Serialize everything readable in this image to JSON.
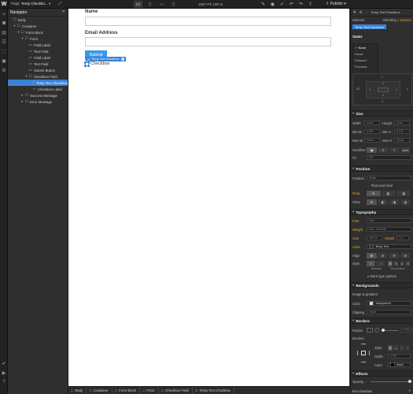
{
  "topbar": {
    "logo": "W",
    "page_label": "Page:",
    "page_name": "Temp Checkbo...",
    "dimensions": "1067 PX  100 %",
    "publish_label": "Publish"
  },
  "navigator": {
    "title": "Navigator",
    "items": [
      {
        "label": "Body",
        "level": 0,
        "caret": "",
        "icon": "☐"
      },
      {
        "label": "Container",
        "level": 1,
        "caret": "▾",
        "icon": "☐"
      },
      {
        "label": "Form Block",
        "level": 2,
        "caret": "▾",
        "icon": "☐"
      },
      {
        "label": "Form",
        "level": 3,
        "caret": "▾",
        "icon": "☐"
      },
      {
        "label": "Field Label",
        "level": 4,
        "caret": "",
        "icon": "▭"
      },
      {
        "label": "Text Field",
        "level": 4,
        "caret": "",
        "icon": "▭"
      },
      {
        "label": "Field Label",
        "level": 4,
        "caret": "",
        "icon": "▭"
      },
      {
        "label": "Text Field",
        "level": 4,
        "caret": "",
        "icon": "▭"
      },
      {
        "label": "Submit Button",
        "level": 4,
        "caret": "",
        "icon": "▭"
      },
      {
        "label": "Checkbox Field",
        "level": 4,
        "caret": "▾",
        "icon": "☐"
      },
      {
        "label": "Temp Text Checkbox",
        "level": 5,
        "caret": "",
        "icon": "☑",
        "selected": true
      },
      {
        "label": "Checkbox Label",
        "level": 5,
        "caret": "",
        "icon": "▭"
      },
      {
        "label": "Success Message",
        "level": 3,
        "caret": "▸",
        "icon": "☐"
      },
      {
        "label": "Error Message",
        "level": 3,
        "caret": "▸",
        "icon": "☐"
      }
    ]
  },
  "canvas": {
    "name_label": "Name",
    "email_label": "Email Address",
    "submit_label": "Submit",
    "element_tag": "Temp Text Checkbox",
    "checkbox_label": "Checkbox"
  },
  "breadcrumbs": [
    "Body",
    "Container",
    "Form Block",
    "Form",
    "Checkbox Field",
    "Temp Text Checkbox"
  ],
  "right_panel": {
    "header_title": "Temp Text Checkbox",
    "selector_label": "Selector",
    "inheriting_label": "Inheriting",
    "inheriting_count": "1 selector",
    "selector_chip": "Temp Text Checkbox",
    "states_title": "States",
    "states": [
      "None",
      "Hover",
      "Pressed",
      "Focused"
    ],
    "box_values": {
      "margin_top": "0",
      "margin_left": "-20",
      "padding_top": "0",
      "padding_left": "0",
      "padding_right": "0",
      "padding_bottom": "0",
      "margin_right": "0",
      "margin_bottom": "0"
    },
    "size": {
      "title": "Size",
      "width_label": "Width",
      "width_value": "Auto",
      "height_label": "Height",
      "height_value": "Auto",
      "minw_label": "Min W",
      "minw_value": "0",
      "minw_unit": "PX",
      "minh_label": "Min H",
      "minh_value": "0",
      "minh_unit": "PX",
      "maxw_label": "Max W",
      "maxw_value": "None",
      "maxh_label": "Max H",
      "maxh_value": "None",
      "overflow_label": "Overflow",
      "overflow_auto": "Auto",
      "fit_label": "Fit",
      "fit_value": "Fill"
    },
    "position": {
      "title": "Position",
      "position_label": "Position",
      "position_value": "Static",
      "float_clear": "Float and clear",
      "float_label": "Float",
      "clear_label": "Clear"
    },
    "typography": {
      "title": "Typography",
      "font_label": "Font",
      "font_value": "Inter",
      "weight_label": "Weight",
      "weight_value": "400 - Normal",
      "size_label": "Size",
      "size_value": "100",
      "size_unit": "%",
      "height_label": "Height",
      "height_value": "1.2",
      "color_label": "Color",
      "color_value": "Body Text",
      "align_label": "Align",
      "style_label": "Style",
      "italicize_label": "Italicize",
      "decoration_label": "Decoration",
      "more_label": "More type options"
    },
    "backgrounds": {
      "title": "Backgrounds",
      "image_gradient": "Image & gradient",
      "color_label": "Color",
      "color_value": "transparent",
      "clipping_label": "Clipping",
      "clipping_value": "None"
    },
    "borders": {
      "title": "Borders",
      "radius_label": "Radius",
      "radius_value": "0",
      "radius_unit": "PX",
      "borders_label": "Borders",
      "style_label": "Style",
      "width_label": "Width",
      "width_value": "0",
      "width_unit": "PX",
      "color_label": "Color",
      "color_value": "black"
    },
    "effects": {
      "title": "Effects",
      "opacity_label": "Opacity",
      "box_shadows": "Box shadows"
    }
  },
  "colors": {
    "accent": "#3a82d6",
    "submit": "#3898ec",
    "label_orange": "#e6a32f"
  }
}
